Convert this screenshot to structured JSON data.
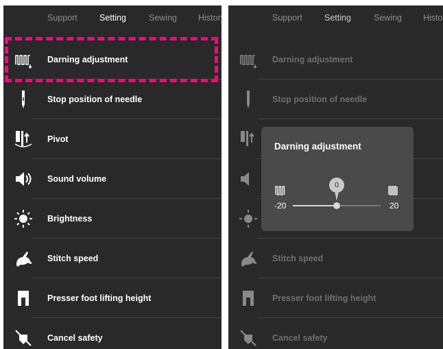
{
  "tabs": [
    "Support",
    "Setting",
    "Sewing",
    "History"
  ],
  "active_tab": "Setting",
  "settings": [
    {
      "label": "Darning adjustment",
      "icon": "darning-icon"
    },
    {
      "label": "Stop position of needle",
      "icon": "needle-icon"
    },
    {
      "label": "Pivot",
      "icon": "pivot-icon"
    },
    {
      "label": "Sound volume",
      "icon": "speaker-icon"
    },
    {
      "label": "Brightness",
      "icon": "brightness-icon"
    },
    {
      "label": "Stitch speed",
      "icon": "rabbit-icon"
    },
    {
      "label": "Presser foot lifting height",
      "icon": "presser-foot-icon"
    },
    {
      "label": "Cancel safety",
      "icon": "cancel-safety-icon"
    }
  ],
  "dialog": {
    "title": "Darning adjustment",
    "value": "0",
    "min_label": "-20",
    "max_label": "20",
    "value_fraction": 0.5
  },
  "colors": {
    "highlight": "#e0127a",
    "panel_bg": "#2a2929"
  }
}
